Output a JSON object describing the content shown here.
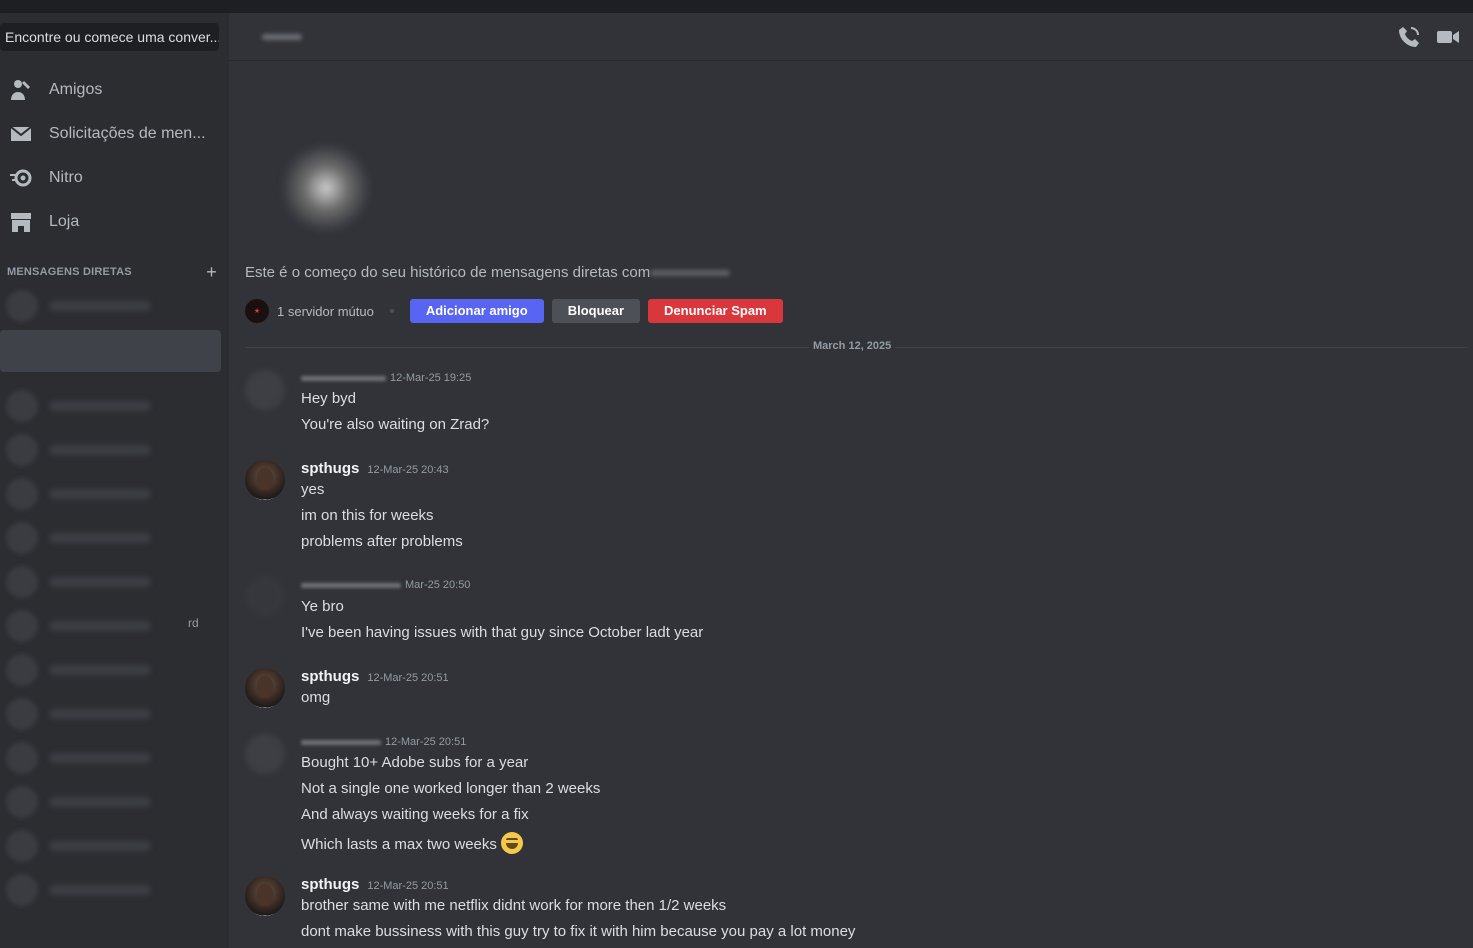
{
  "sidebar": {
    "search_placeholder": "Encontre ou comece uma conver...",
    "nav": [
      {
        "label": "Amigos",
        "icon": "friends-icon"
      },
      {
        "label": "Solicitações de men...",
        "icon": "envelope-icon"
      },
      {
        "label": "Nitro",
        "icon": "nitro-icon"
      },
      {
        "label": "Loja",
        "icon": "shop-icon"
      }
    ],
    "dm_header": "MENSAGENS DIRETAS",
    "dm_add": "+",
    "dm_trailing_text": "rd"
  },
  "chat": {
    "intro_text": "Este é o começo do seu histórico de mensagens diretas com",
    "mutual_servers": "1 servidor mútuo",
    "buttons": {
      "add_friend": "Adicionar amigo",
      "block": "Bloquear",
      "report_spam": "Denunciar Spam"
    },
    "date_divider": "March 12, 2025",
    "messages": [
      {
        "author": "",
        "timestamp": "12-Mar-25 19:25",
        "lines": [
          "Hey byd",
          "You're also waiting on Zrad?"
        ]
      },
      {
        "author": "spthugs",
        "timestamp": "12-Mar-25 20:43",
        "lines": [
          "yes",
          "im on this for weeks",
          "problems after problems"
        ]
      },
      {
        "author": "",
        "timestamp": "Mar-25 20:50",
        "lines": [
          "Ye bro",
          "I've been having issues with that guy since October ladt year"
        ]
      },
      {
        "author": "spthugs",
        "timestamp": "12-Mar-25 20:51",
        "lines": [
          "omg"
        ]
      },
      {
        "author": "",
        "timestamp": "12-Mar-25 20:51",
        "lines": [
          "Bought 10+ Adobe subs for a year",
          "Not a single one worked longer than 2 weeks",
          "And always waiting weeks for a fix",
          "Which lasts a max two weeks"
        ]
      },
      {
        "author": "spthugs",
        "timestamp": "12-Mar-25 20:51",
        "lines": [
          "brother  same  with me netflix didnt work for more then 1/2 weeks",
          "dont make bussiness with this guy try to fix it with him because you pay a lot money"
        ]
      }
    ]
  }
}
